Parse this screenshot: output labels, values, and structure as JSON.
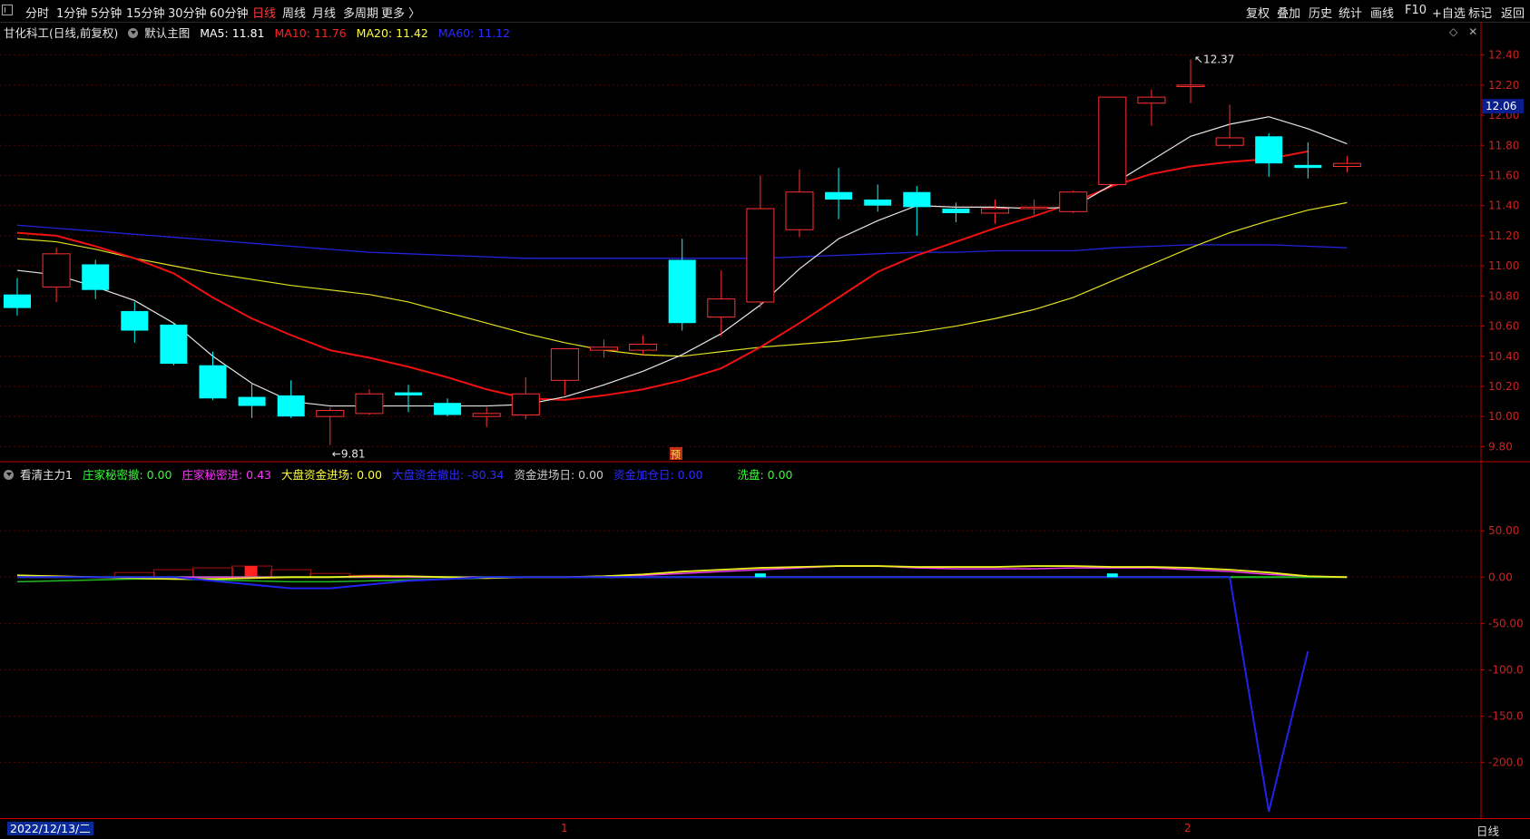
{
  "toolbar": {
    "periods": [
      "分时",
      "1分钟",
      "5分钟",
      "15分钟",
      "30分钟",
      "60分钟",
      "日线",
      "周线",
      "月线",
      "多周期",
      "更多 〉"
    ],
    "active_period": "日线",
    "actions": [
      "复权",
      "叠加",
      "历史",
      "统计",
      "画线",
      "F10",
      "+自选",
      "标记",
      "返回"
    ]
  },
  "main_panel": {
    "stock_title": "甘化科工(日线,前复权)",
    "template": "默认主图",
    "ma": [
      {
        "label": "MA5: 11.81",
        "color": "#ffffff"
      },
      {
        "label": "MA10: 11.76",
        "color": "#ff2020"
      },
      {
        "label": "MA20: 11.42",
        "color": "#ffff33"
      },
      {
        "label": "MA60: 11.12",
        "color": "#2b2bff"
      }
    ],
    "price_labels": [
      "12.40",
      "12.20",
      "12.00",
      "11.80",
      "11.60",
      "11.40",
      "11.20",
      "11.00",
      "10.80",
      "10.60",
      "10.40",
      "10.20",
      "10.00",
      "9.80"
    ],
    "current_price": "12.06",
    "high_annotation": "12.37",
    "low_annotation": "9.81",
    "pre_marker": "预"
  },
  "sub_panel": {
    "indicator_name": "看清主力1",
    "fields": [
      {
        "label": "庄家秘密撤: 0.00",
        "color": "#33ff33"
      },
      {
        "label": "庄家秘密进: 0.43",
        "color": "#ff33ff"
      },
      {
        "label": "大盘资金进场: 0.00",
        "color": "#ffff33"
      },
      {
        "label": "大盘资金撤出: -80.34",
        "color": "#2b2bff"
      },
      {
        "label": "资金进场日: 0.00",
        "color": "#cccccc"
      },
      {
        "label": "资金加仓日: 0.00",
        "color": "#2b2bff"
      },
      {
        "label": "洗盘: 0.00",
        "color": "#33ff33"
      }
    ],
    "axis_labels": [
      "50.00",
      "0.00",
      "-50.00",
      "-100.0",
      "-150.0",
      "-200.0"
    ]
  },
  "bottom": {
    "date": "2022/12/13/二",
    "month_marks": [
      "1",
      "2"
    ],
    "period": "日线"
  },
  "colors": {
    "up": "#ff3030",
    "down": "#00ffff",
    "grid": "#5a0000",
    "axis": "#c00000"
  },
  "chart_data": {
    "type": "candlestick",
    "ylim": [
      9.7,
      12.5
    ],
    "candles": [
      {
        "o": 10.81,
        "h": 10.92,
        "l": 10.67,
        "c": 10.72
      },
      {
        "o": 10.86,
        "h": 11.12,
        "l": 10.76,
        "c": 11.08
      },
      {
        "o": 11.01,
        "h": 11.04,
        "l": 10.78,
        "c": 10.84
      },
      {
        "o": 10.7,
        "h": 10.76,
        "l": 10.49,
        "c": 10.57
      },
      {
        "o": 10.61,
        "h": 10.62,
        "l": 10.34,
        "c": 10.35
      },
      {
        "o": 10.34,
        "h": 10.43,
        "l": 10.11,
        "c": 10.12
      },
      {
        "o": 10.13,
        "h": 10.22,
        "l": 9.99,
        "c": 10.07
      },
      {
        "o": 10.14,
        "h": 10.24,
        "l": 9.99,
        "c": 10.0
      },
      {
        "o": 10.0,
        "h": 10.06,
        "l": 9.81,
        "c": 10.04
      },
      {
        "o": 10.02,
        "h": 10.18,
        "l": 10.01,
        "c": 10.15
      },
      {
        "o": 10.16,
        "h": 10.21,
        "l": 10.03,
        "c": 10.14
      },
      {
        "o": 10.09,
        "h": 10.12,
        "l": 10.0,
        "c": 10.01
      },
      {
        "o": 10.0,
        "h": 10.06,
        "l": 9.93,
        "c": 10.02
      },
      {
        "o": 10.01,
        "h": 10.26,
        "l": 9.98,
        "c": 10.15
      },
      {
        "o": 10.24,
        "h": 10.45,
        "l": 10.14,
        "c": 10.45
      },
      {
        "o": 10.44,
        "h": 10.51,
        "l": 10.39,
        "c": 10.46
      },
      {
        "o": 10.44,
        "h": 10.54,
        "l": 10.41,
        "c": 10.48
      },
      {
        "o": 11.04,
        "h": 11.18,
        "l": 10.57,
        "c": 10.62
      },
      {
        "o": 10.66,
        "h": 10.97,
        "l": 10.53,
        "c": 10.78
      },
      {
        "o": 10.76,
        "h": 11.6,
        "l": 10.72,
        "c": 11.38
      },
      {
        "o": 11.24,
        "h": 11.64,
        "l": 11.19,
        "c": 11.49
      },
      {
        "o": 11.49,
        "h": 11.65,
        "l": 11.31,
        "c": 11.44
      },
      {
        "o": 11.44,
        "h": 11.54,
        "l": 11.36,
        "c": 11.4
      },
      {
        "o": 11.49,
        "h": 11.53,
        "l": 11.2,
        "c": 11.39
      },
      {
        "o": 11.38,
        "h": 11.42,
        "l": 11.29,
        "c": 11.35
      },
      {
        "o": 11.35,
        "h": 11.44,
        "l": 11.28,
        "c": 11.38
      },
      {
        "o": 11.38,
        "h": 11.44,
        "l": 11.34,
        "c": 11.39
      },
      {
        "o": 11.36,
        "h": 11.5,
        "l": 11.35,
        "c": 11.49
      },
      {
        "o": 11.54,
        "h": 12.12,
        "l": 11.54,
        "c": 12.12
      },
      {
        "o": 12.08,
        "h": 12.17,
        "l": 11.93,
        "c": 12.12
      },
      {
        "o": 12.19,
        "h": 12.37,
        "l": 12.08,
        "c": 12.2
      },
      {
        "o": 11.8,
        "h": 12.07,
        "l": 11.78,
        "c": 11.85
      },
      {
        "o": 11.86,
        "h": 11.88,
        "l": 11.59,
        "c": 11.68
      },
      {
        "o": 11.67,
        "h": 11.82,
        "l": 11.58,
        "c": 11.65
      },
      {
        "o": 11.66,
        "h": 11.73,
        "l": 11.62,
        "c": 11.68
      }
    ],
    "ma5": [
      10.97,
      10.94,
      10.86,
      10.77,
      10.62,
      10.4,
      10.22,
      10.1,
      10.07,
      10.07,
      10.07,
      10.07,
      10.07,
      10.08,
      10.13,
      10.21,
      10.3,
      10.41,
      10.55,
      10.74,
      10.98,
      11.18,
      11.3,
      11.4,
      11.39,
      11.39,
      11.38,
      11.39,
      11.54,
      11.7,
      11.86,
      11.94,
      11.99,
      11.91,
      11.81
    ],
    "ma10": [
      11.22,
      11.2,
      11.13,
      11.05,
      10.95,
      10.79,
      10.65,
      10.54,
      10.44,
      10.39,
      10.33,
      10.26,
      10.18,
      10.12,
      10.11,
      10.14,
      10.18,
      10.24,
      10.32,
      10.46,
      10.62,
      10.79,
      10.96,
      11.07,
      11.16,
      11.25,
      11.33,
      11.42,
      11.53,
      11.61,
      11.66,
      11.69,
      11.71,
      11.76
    ],
    "ma20": [
      11.18,
      11.16,
      11.11,
      11.05,
      11.0,
      10.95,
      10.91,
      10.87,
      10.84,
      10.81,
      10.76,
      10.69,
      10.62,
      10.55,
      10.49,
      10.44,
      10.41,
      10.4,
      10.43,
      10.46,
      10.48,
      10.5,
      10.53,
      10.56,
      10.6,
      10.65,
      10.71,
      10.79,
      10.9,
      11.01,
      11.12,
      11.22,
      11.3,
      11.37,
      11.42
    ],
    "ma60": [
      11.27,
      11.25,
      11.23,
      11.21,
      11.19,
      11.17,
      11.15,
      11.13,
      11.11,
      11.09,
      11.08,
      11.07,
      11.06,
      11.05,
      11.05,
      11.05,
      11.05,
      11.05,
      11.05,
      11.05,
      11.06,
      11.07,
      11.08,
      11.09,
      11.09,
      11.1,
      11.1,
      11.1,
      11.12,
      11.13,
      11.14,
      11.14,
      11.14,
      11.13,
      11.12
    ],
    "sub": {
      "ylim": [
        -260,
        105
      ],
      "yellow": [
        2,
        1,
        0,
        -1,
        -2,
        -2,
        -1,
        0,
        0,
        1,
        1,
        0,
        -1,
        0,
        0,
        1,
        3,
        6,
        8,
        10,
        11,
        12,
        12,
        11,
        11,
        11,
        12,
        12,
        11,
        11,
        10,
        8,
        5,
        1,
        0
      ],
      "magenta": [
        0,
        0,
        0,
        0,
        0,
        0,
        0,
        0,
        0,
        0,
        0,
        0,
        0,
        0,
        0,
        1,
        2,
        4,
        6,
        8,
        10,
        12,
        12,
        10,
        9,
        9,
        9,
        10,
        10,
        10,
        8,
        6,
        3,
        1,
        0
      ],
      "blue": [
        0,
        0,
        0,
        0,
        0,
        -4,
        -8,
        -12,
        -12,
        -8,
        -4,
        -2,
        0,
        0,
        0,
        0,
        0,
        0,
        0,
        0,
        0,
        0,
        0,
        0,
        0,
        0,
        0,
        0,
        0,
        0,
        0,
        0,
        -253,
        -80
      ],
      "green_pos": [
        -5,
        -4,
        -3,
        -2,
        -2,
        -3,
        -4,
        -5,
        -5,
        -4,
        -3,
        -2,
        -1,
        0,
        0,
        0,
        0,
        0,
        0,
        0,
        0,
        0,
        0,
        0,
        0,
        0,
        0,
        0,
        0,
        0,
        0,
        0,
        0,
        0,
        0
      ],
      "red_boxes": [
        [
          3,
          5
        ],
        [
          4,
          8
        ],
        [
          5,
          10
        ],
        [
          6,
          12
        ],
        [
          7,
          8
        ],
        [
          8,
          4
        ],
        [
          9,
          2
        ]
      ],
      "cyan_marks": [
        19,
        28
      ]
    }
  }
}
